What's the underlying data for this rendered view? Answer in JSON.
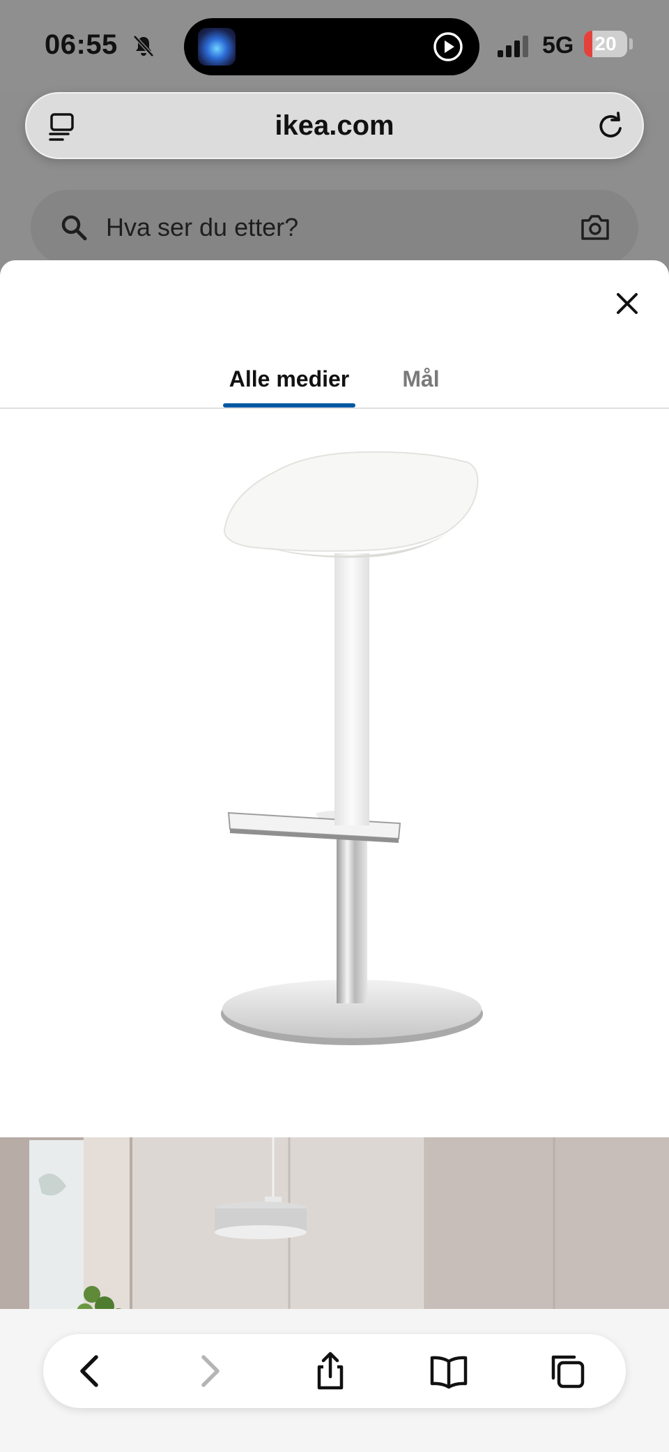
{
  "status_bar": {
    "time": "06:55",
    "network": "5G",
    "battery_level": 20,
    "battery_text": "20",
    "battery_color": "#e5413b"
  },
  "browser": {
    "url": "ikea.com",
    "reader_icon": "reader-mode-icon",
    "reload_icon": "reload-icon"
  },
  "page": {
    "search_placeholder": "Hva ser du etter?",
    "search_icon": "search-icon",
    "camera_icon": "camera-icon"
  },
  "media_modal": {
    "close_icon": "close-icon",
    "tabs": [
      {
        "label": "Alle medier",
        "active": true
      },
      {
        "label": "Mål",
        "active": false
      }
    ],
    "accent_color": "#0058a3",
    "images": [
      {
        "name": "product-image-bar-stool"
      },
      {
        "name": "room-image-kitchen"
      }
    ]
  },
  "toolbar": {
    "buttons": [
      "back-icon",
      "forward-icon",
      "share-icon",
      "bookmarks-icon",
      "tabs-icon"
    ]
  }
}
